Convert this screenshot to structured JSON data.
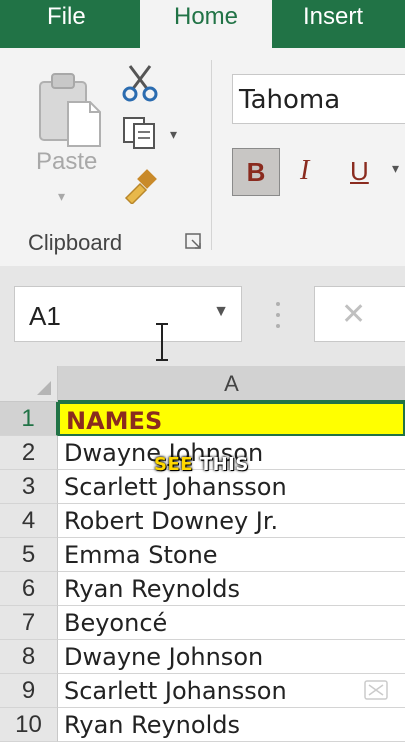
{
  "tabs": {
    "file": "File",
    "home": "Home",
    "insert": "Insert"
  },
  "clipboard": {
    "paste_label": "Paste",
    "group_label": "Clipboard"
  },
  "font": {
    "name": "Tahoma",
    "bold": "B",
    "italic": "I",
    "underline": "U"
  },
  "formula_bar": {
    "name_box": "A1",
    "cancel": "✕"
  },
  "sheet": {
    "column": "A",
    "rows": [
      {
        "num": "1",
        "value": "NAMES"
      },
      {
        "num": "2",
        "value": "Dwayne Johnson"
      },
      {
        "num": "3",
        "value": "Scarlett Johansson"
      },
      {
        "num": "4",
        "value": "Robert Downey Jr."
      },
      {
        "num": "5",
        "value": "Emma Stone"
      },
      {
        "num": "6",
        "value": "Ryan Reynolds"
      },
      {
        "num": "7",
        "value": "Beyoncé"
      },
      {
        "num": "8",
        "value": "Dwayne Johnson"
      },
      {
        "num": "9",
        "value": "Scarlett Johansson"
      },
      {
        "num": "10",
        "value": "Ryan Reynolds"
      }
    ]
  },
  "overlay": {
    "word1": "SEE",
    "word2": "THIS"
  },
  "colors": {
    "brand": "#217346",
    "header_fill": "#ffff00",
    "header_text": "#8a2b1f"
  }
}
